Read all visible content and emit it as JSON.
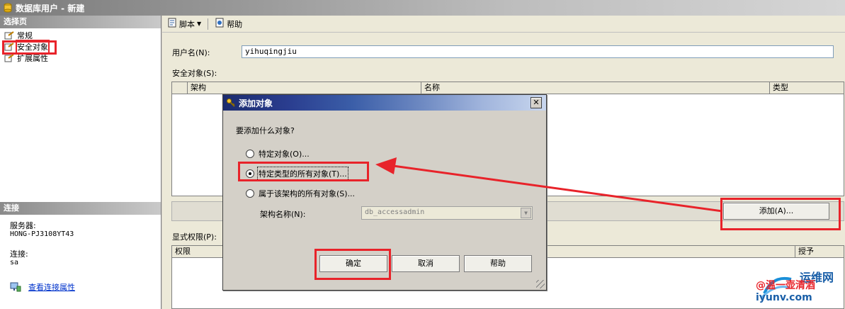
{
  "window": {
    "title": "数据库用户 - 新建"
  },
  "left_panel": {
    "pages_header": "选择页",
    "pages": [
      {
        "label": "常规",
        "selected": false
      },
      {
        "label": "安全对象",
        "selected": true
      },
      {
        "label": "扩展属性",
        "selected": false
      }
    ],
    "connection_header": "连接",
    "server_label": "服务器:",
    "server_value": "HONG-PJ3108YT43",
    "connection_label": "连接:",
    "connection_value": "sa",
    "view_connection_link": "查看连接属性"
  },
  "toolbar": {
    "script_label": "脚本",
    "help_label": "帮助"
  },
  "form": {
    "username_label": "用户名(N):",
    "username_value": "yihuqingjiu",
    "securables_label": "安全对象(S):",
    "securables_columns": [
      "架构",
      "名称",
      "类型"
    ],
    "add_button": "添加(A)...",
    "permissions_label": "显式权限(P):",
    "permissions_columns": [
      "权限",
      "授予"
    ]
  },
  "dialog": {
    "title": "添加对象",
    "prompt": "要添加什么对象?",
    "options": [
      {
        "label": "特定对象(O)...",
        "selected": false
      },
      {
        "label": "特定类型的所有对象(T)...",
        "selected": true
      },
      {
        "label": "属于该架构的所有对象(S)...",
        "selected": false
      }
    ],
    "schema_label": "架构名称(N):",
    "schema_value": "db_accessadmin",
    "ok_button": "确定",
    "cancel_button": "取消",
    "help_button": "帮助",
    "close_glyph": "✕"
  },
  "watermark": {
    "title": "运维网",
    "subtitle": "@温一壶清酒",
    "url": "iyunv.com"
  },
  "colors": {
    "annotation_red": "#e8232a",
    "link_blue": "#0033cc"
  }
}
